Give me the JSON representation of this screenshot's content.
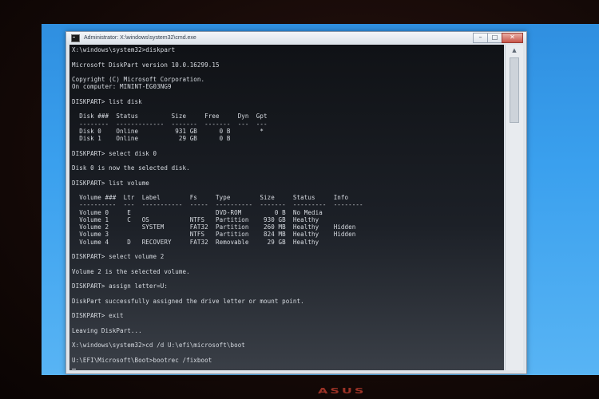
{
  "window": {
    "title": "Administrator: X:\\windows\\system32\\cmd.exe",
    "icon": "console-icon",
    "buttons": {
      "minimize": "–",
      "maximize": "□",
      "close": "✕"
    }
  },
  "console": {
    "lines": [
      "X:\\windows\\system32>diskpart",
      "",
      "Microsoft DiskPart version 10.0.16299.15",
      "",
      "Copyright (C) Microsoft Corporation.",
      "On computer: MININT-EG03NG9",
      "",
      "DISKPART> list disk",
      "",
      "  Disk ###  Status         Size     Free     Dyn  Gpt",
      "  --------  -------------  -------  -------  ---  ---",
      "  Disk 0    Online          931 GB      0 B        *",
      "  Disk 1    Online           29 GB      0 B",
      "",
      "DISKPART> select disk 0",
      "",
      "Disk 0 is now the selected disk.",
      "",
      "DISKPART> list volume",
      "",
      "  Volume ###  Ltr  Label        Fs     Type        Size     Status     Info",
      "  ----------  ---  -----------  -----  ----------  -------  ---------  --------",
      "  Volume 0     E                       DVD-ROM         0 B  No Media",
      "  Volume 1     C   OS           NTFS   Partition    930 GB  Healthy",
      "  Volume 2         SYSTEM       FAT32  Partition    260 MB  Healthy    Hidden",
      "  Volume 3                      NTFS   Partition    824 MB  Healthy    Hidden",
      "  Volume 4     D   RECOVERY     FAT32  Removable     29 GB  Healthy",
      "",
      "DISKPART> select volume 2",
      "",
      "Volume 2 is the selected volume.",
      "",
      "DISKPART> assign letter=U:",
      "",
      "DiskPart successfully assigned the drive letter or mount point.",
      "",
      "DISKPART> exit",
      "",
      "Leaving DiskPart...",
      "",
      "X:\\windows\\system32>cd /d U:\\efi\\microsoft\\boot",
      "",
      "U:\\EFI\\Microsoft\\Boot>bootrec /fixboot"
    ]
  },
  "bezel": {
    "logo": "ASUS"
  },
  "colors": {
    "desktop": "#3aa0ee",
    "console_bg": "#16191e",
    "console_text": "#d8dce2",
    "bezel_logo": "#b43a2c"
  }
}
